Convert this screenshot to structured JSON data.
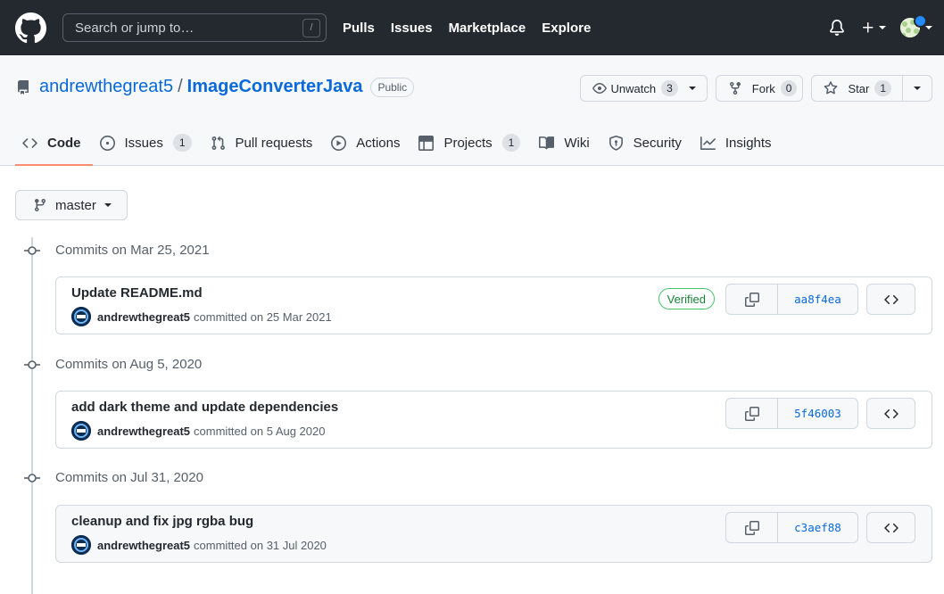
{
  "header": {
    "search_placeholder": "Search or jump to…",
    "search_shortcut": "/",
    "nav": [
      "Pulls",
      "Issues",
      "Marketplace",
      "Explore"
    ]
  },
  "repo": {
    "owner": "andrewthegreat5",
    "separator": "/",
    "name": "ImageConverterJava",
    "visibility": "Public",
    "watch": {
      "label": "Unwatch",
      "count": "3"
    },
    "fork": {
      "label": "Fork",
      "count": "0"
    },
    "star": {
      "label": "Star",
      "count": "1"
    }
  },
  "tabs": [
    {
      "label": "Code",
      "icon": "code-icon",
      "selected": true
    },
    {
      "label": "Issues",
      "icon": "issue-opened-icon",
      "count": "1"
    },
    {
      "label": "Pull requests",
      "icon": "git-pull-request-icon"
    },
    {
      "label": "Actions",
      "icon": "play-icon"
    },
    {
      "label": "Projects",
      "icon": "table-icon",
      "count": "1"
    },
    {
      "label": "Wiki",
      "icon": "book-icon"
    },
    {
      "label": "Security",
      "icon": "shield-icon"
    },
    {
      "label": "Insights",
      "icon": "graph-icon"
    }
  ],
  "branch": {
    "label": "master"
  },
  "commit_groups": [
    {
      "heading": "Commits on Mar 25, 2021",
      "commit": {
        "message": "Update README.md",
        "author": "andrewthegreat5",
        "committed": "committed on 25 Mar 2021",
        "verified": "Verified",
        "sha": "aa8f4ea"
      }
    },
    {
      "heading": "Commits on Aug 5, 2020",
      "commit": {
        "message": "add dark theme and update dependencies",
        "author": "andrewthegreat5",
        "committed": "committed on 5 Aug 2020",
        "sha": "5f46003"
      }
    },
    {
      "heading": "Commits on Jul 31, 2020",
      "commit": {
        "message": "cleanup and fix jpg rgba bug",
        "author": "andrewthegreat5",
        "committed": "committed on 31 Jul 2020",
        "sha": "c3aef88"
      }
    }
  ],
  "colors": {
    "header_bg": "#24292f",
    "link": "#0969da",
    "selected_tab_underline": "#fd8c73",
    "verified": "#1a7f37"
  }
}
